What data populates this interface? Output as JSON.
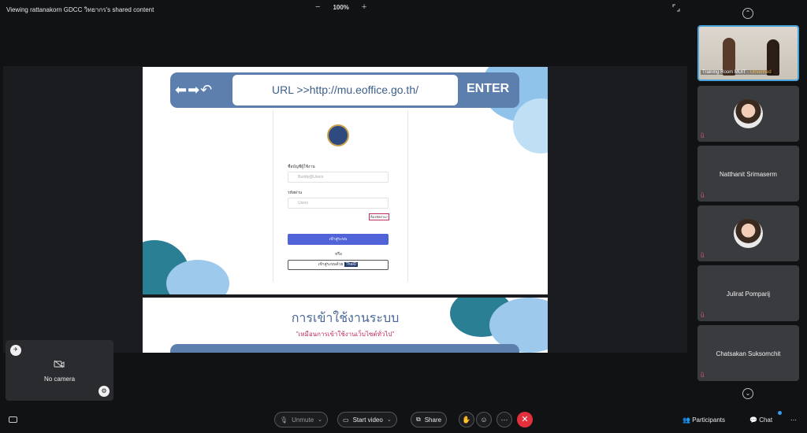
{
  "topbar": {
    "share_title": "Viewing rattanakorn GDCC วิทยากร's shared content",
    "zoom_out": "−",
    "zoom_value": "100%",
    "zoom_in": "+"
  },
  "slide1": {
    "nav_arrows": "⬅➡↶",
    "url_text": "URL >>http://mu.eoffice.go.th/",
    "enter_label": "ENTER",
    "username_label": "ชื่อบัญชีผู้ใช้งาน",
    "username_placeholder": "Buddy@Users",
    "password_label": "รหัสผ่าน",
    "password_placeholder": "Users",
    "forgot_label": "ลืมรหัสผ่าน?",
    "login_button": "เข้าสู่ระบบ",
    "or_text": "หรือ",
    "thaid_label": "เข้าสู่ระบบด้วย",
    "thaid_tag": "ThaID"
  },
  "slide2": {
    "title": "การเข้าใช้งานระบบ",
    "subtitle": "\"เหมือนการเข้าใช้งานเว็บไซต์ทั่วไป\""
  },
  "participants_panel": {
    "active_caption": "Training Room MUIT",
    "active_status": "Unverified",
    "tiles": [
      {
        "name": "",
        "has_avatar": true
      },
      {
        "name": "Natthanit Srimaserm",
        "has_avatar": false
      },
      {
        "name": "",
        "has_avatar": true
      },
      {
        "name": "Julirat Pomparij",
        "has_avatar": false
      },
      {
        "name": "Chatsakan Suksomchit",
        "has_avatar": false
      }
    ]
  },
  "self_view": {
    "no_camera": "No camera"
  },
  "bottombar": {
    "unmute": "Unmute",
    "start_video": "Start video",
    "share": "Share",
    "participants": "Participants",
    "chat": "Chat"
  },
  "colors": {
    "accent": "#4aa3d9",
    "leave": "#e2313d",
    "url_bar": "#5d7fad",
    "login_button": "#5163d9"
  }
}
